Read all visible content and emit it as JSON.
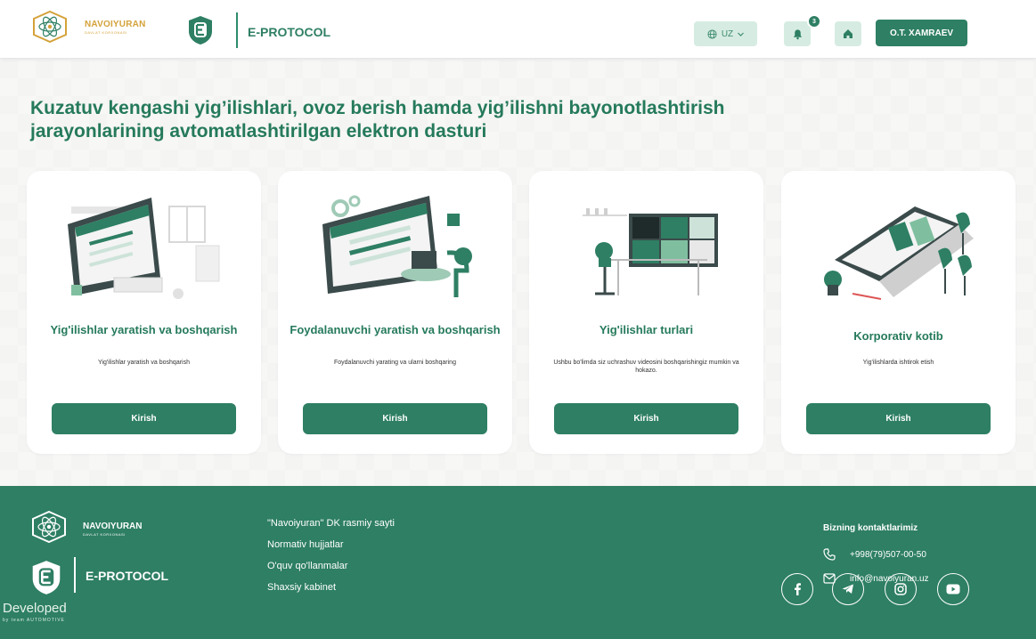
{
  "header": {
    "brand_name": "NAVOIYURAN",
    "brand_sub": "DAVLAT KORXONASI",
    "app_title": "E-PROTOCOL",
    "language": "UZ",
    "notification_count": "3",
    "user_name": "O.T. XAMRAEV"
  },
  "hero": {
    "title_line1": "Kuzatuv kengashi yig’ilishlari, ovoz berish hamda yig’ilishni bayonotlashtirish",
    "title_line2": "jarayonlarining avtomatlashtirilgan elektron dasturi"
  },
  "cards": [
    {
      "title": "Yig'ilishlar yaratish va boshqarish",
      "desc": "Yig'ilishlar yaratish va boshqarish",
      "button": "Kirish"
    },
    {
      "title": "Foydalanuvchi yaratish va boshqarish",
      "desc": "Foydalanuvchi yarating va ularni boshqaring",
      "button": "Kirish"
    },
    {
      "title": "Yig'ilishlar turlari",
      "desc": "Ushbu bo'limda siz uchrashuv videosini boshqarishingiz mumkin va hokazo.",
      "button": "Kirish"
    },
    {
      "title": "Korporativ kotib",
      "desc": "Yig'ilishlarda ishtirok etish",
      "button": "Kirish"
    }
  ],
  "footer": {
    "brand_name": "NAVOIYURAN",
    "brand_sub": "DAVLAT KORXONASI",
    "app_title": "E-PROTOCOL",
    "developed": "Developed",
    "developed_by": "by team AUTOMOTIVE",
    "links": [
      "\"Navoiyuran\" DK rasmiy sayti",
      "Normativ hujjatlar",
      "O'quv qo'llanmalar",
      "Shaxsiy kabinet"
    ],
    "contacts_title": "Bizning kontaktlarimiz",
    "phone": "+998(79)507-00-50",
    "email": "info@navoiyuran.uz"
  },
  "colors": {
    "primary": "#2e7f63",
    "primary_light": "#d6ece2",
    "brand_gold": "#d4a23a",
    "background": "#f4f4f3"
  },
  "icons": [
    "globe-icon",
    "chevron-down-icon",
    "bell-icon",
    "home-icon",
    "phone-icon",
    "mail-icon",
    "facebook-icon",
    "telegram-icon",
    "instagram-icon",
    "youtube-icon"
  ]
}
